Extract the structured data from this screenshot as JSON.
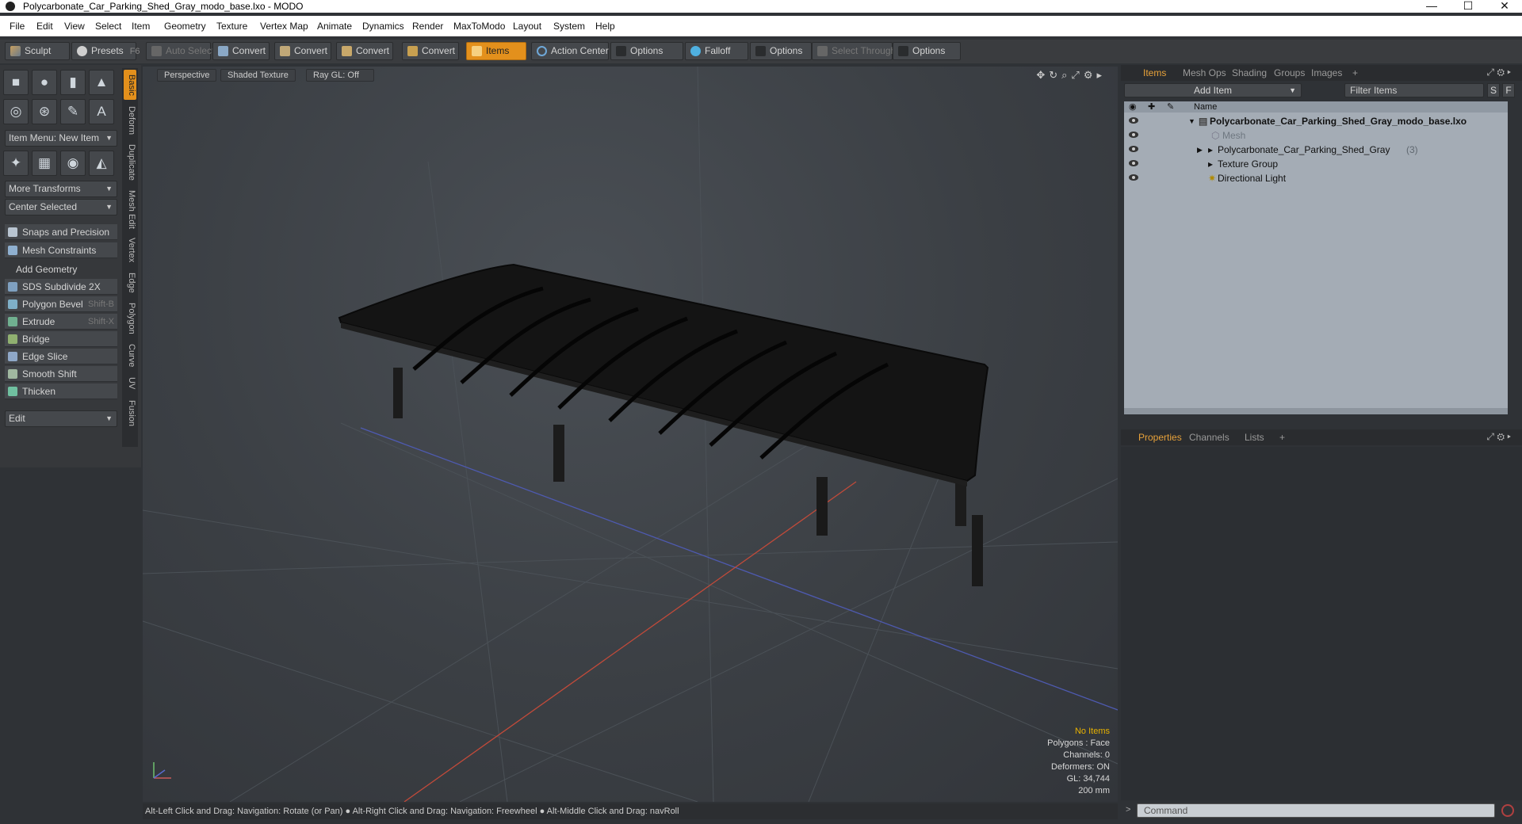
{
  "window": {
    "title": "Polycarbonate_Car_Parking_Shed_Gray_modo_base.lxo - MODO",
    "minimize": "—",
    "maximize": "☐",
    "close": "✕"
  },
  "menu": [
    "File",
    "Edit",
    "View",
    "Select",
    "Item",
    "Geometry",
    "Texture",
    "Vertex Map",
    "Animate",
    "Dynamics",
    "Render",
    "MaxToModo",
    "Layout",
    "System",
    "Help"
  ],
  "toolbar": {
    "sculpt": "Sculpt",
    "presets": "Presets",
    "presets_key": "F6",
    "auto_select": "Auto Select",
    "convert1": "Convert",
    "convert2": "Convert",
    "convert3": "Convert",
    "convert4": "Convert",
    "items": "Items",
    "action_center": "Action Center",
    "options1": "Options",
    "falloff": "Falloff",
    "options2": "Options",
    "select_through": "Select Through",
    "options3": "Options"
  },
  "left": {
    "item_menu": "Item Menu: New Item",
    "more_transforms": "More Transforms",
    "center_selected": "Center Selected",
    "snaps": "Snaps and Precision",
    "mesh_constraints": "Mesh Constraints",
    "add_geometry": "Add Geometry",
    "tools": [
      {
        "label": "SDS Subdivide 2X",
        "key": ""
      },
      {
        "label": "Polygon Bevel",
        "key": "Shift-B"
      },
      {
        "label": "Extrude",
        "key": "Shift-X"
      },
      {
        "label": "Bridge",
        "key": ""
      },
      {
        "label": "Edge Slice",
        "key": ""
      },
      {
        "label": "Smooth Shift",
        "key": ""
      },
      {
        "label": "Thicken",
        "key": ""
      }
    ],
    "edit": "Edit",
    "vtabs": [
      "Basic",
      "Deform",
      "Duplicate",
      "Mesh Edit",
      "Vertex",
      "Edge",
      "Polygon",
      "Curve",
      "UV",
      "Fusion"
    ]
  },
  "viewport": {
    "perspective": "Perspective",
    "shading": "Shaded Texture",
    "raygl": "Ray GL: Off",
    "hud": {
      "items": "No Items",
      "polygons": "Polygons : Face",
      "channels": "Channels: 0",
      "deformers": "Deformers: ON",
      "gl": "GL: 34,744",
      "scale": "200 mm"
    }
  },
  "status": "Alt-Left Click and Drag: Navigation: Rotate (or Pan) ● Alt-Right Click and Drag: Navigation: Freewheel ● Alt-Middle Click and Drag: navRoll",
  "items_panel": {
    "tabs": [
      "Items",
      "Mesh Ops",
      "Shading",
      "Groups",
      "Images",
      "+"
    ],
    "add_item": "Add Item",
    "filter": "Filter Items",
    "s": "S",
    "f": "F",
    "name_header": "Name",
    "rows": [
      {
        "label": "Polycarbonate_Car_Parking_Shed_Gray_modo_base.lxo",
        "count": ""
      },
      {
        "label": "Mesh",
        "count": ""
      },
      {
        "label": "Polycarbonate_Car_Parking_Shed_Gray",
        "count": "(3)"
      },
      {
        "label": "Texture Group",
        "count": ""
      },
      {
        "label": "Directional Light",
        "count": ""
      }
    ]
  },
  "props_panel": {
    "tabs": [
      "Properties",
      "Channels",
      "Lists",
      "+"
    ]
  },
  "command": "Command"
}
